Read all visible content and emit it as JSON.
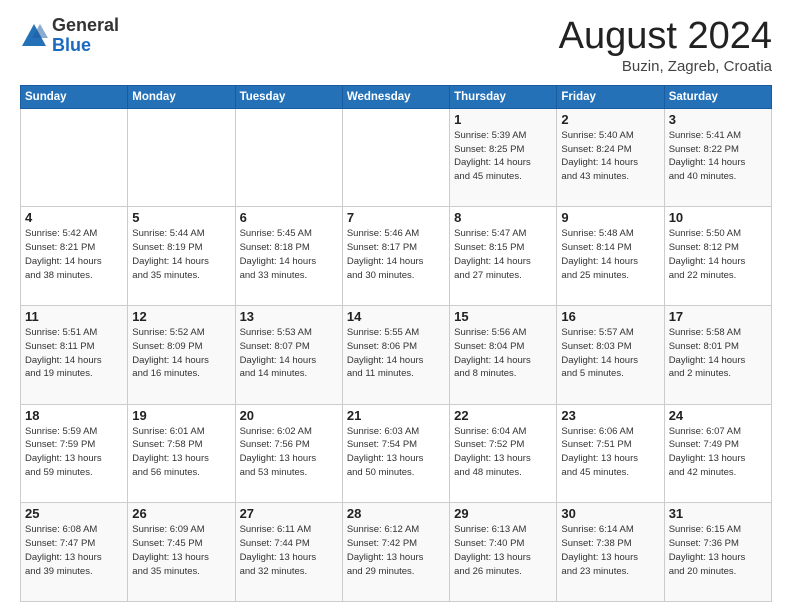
{
  "header": {
    "logo_general": "General",
    "logo_blue": "Blue",
    "month_title": "August 2024",
    "location": "Buzin, Zagreb, Croatia"
  },
  "days_of_week": [
    "Sunday",
    "Monday",
    "Tuesday",
    "Wednesday",
    "Thursday",
    "Friday",
    "Saturday"
  ],
  "weeks": [
    [
      {
        "day": "",
        "content": ""
      },
      {
        "day": "",
        "content": ""
      },
      {
        "day": "",
        "content": ""
      },
      {
        "day": "",
        "content": ""
      },
      {
        "day": "1",
        "content": "Sunrise: 5:39 AM\nSunset: 8:25 PM\nDaylight: 14 hours\nand 45 minutes."
      },
      {
        "day": "2",
        "content": "Sunrise: 5:40 AM\nSunset: 8:24 PM\nDaylight: 14 hours\nand 43 minutes."
      },
      {
        "day": "3",
        "content": "Sunrise: 5:41 AM\nSunset: 8:22 PM\nDaylight: 14 hours\nand 40 minutes."
      }
    ],
    [
      {
        "day": "4",
        "content": "Sunrise: 5:42 AM\nSunset: 8:21 PM\nDaylight: 14 hours\nand 38 minutes."
      },
      {
        "day": "5",
        "content": "Sunrise: 5:44 AM\nSunset: 8:19 PM\nDaylight: 14 hours\nand 35 minutes."
      },
      {
        "day": "6",
        "content": "Sunrise: 5:45 AM\nSunset: 8:18 PM\nDaylight: 14 hours\nand 33 minutes."
      },
      {
        "day": "7",
        "content": "Sunrise: 5:46 AM\nSunset: 8:17 PM\nDaylight: 14 hours\nand 30 minutes."
      },
      {
        "day": "8",
        "content": "Sunrise: 5:47 AM\nSunset: 8:15 PM\nDaylight: 14 hours\nand 27 minutes."
      },
      {
        "day": "9",
        "content": "Sunrise: 5:48 AM\nSunset: 8:14 PM\nDaylight: 14 hours\nand 25 minutes."
      },
      {
        "day": "10",
        "content": "Sunrise: 5:50 AM\nSunset: 8:12 PM\nDaylight: 14 hours\nand 22 minutes."
      }
    ],
    [
      {
        "day": "11",
        "content": "Sunrise: 5:51 AM\nSunset: 8:11 PM\nDaylight: 14 hours\nand 19 minutes."
      },
      {
        "day": "12",
        "content": "Sunrise: 5:52 AM\nSunset: 8:09 PM\nDaylight: 14 hours\nand 16 minutes."
      },
      {
        "day": "13",
        "content": "Sunrise: 5:53 AM\nSunset: 8:07 PM\nDaylight: 14 hours\nand 14 minutes."
      },
      {
        "day": "14",
        "content": "Sunrise: 5:55 AM\nSunset: 8:06 PM\nDaylight: 14 hours\nand 11 minutes."
      },
      {
        "day": "15",
        "content": "Sunrise: 5:56 AM\nSunset: 8:04 PM\nDaylight: 14 hours\nand 8 minutes."
      },
      {
        "day": "16",
        "content": "Sunrise: 5:57 AM\nSunset: 8:03 PM\nDaylight: 14 hours\nand 5 minutes."
      },
      {
        "day": "17",
        "content": "Sunrise: 5:58 AM\nSunset: 8:01 PM\nDaylight: 14 hours\nand 2 minutes."
      }
    ],
    [
      {
        "day": "18",
        "content": "Sunrise: 5:59 AM\nSunset: 7:59 PM\nDaylight: 13 hours\nand 59 minutes."
      },
      {
        "day": "19",
        "content": "Sunrise: 6:01 AM\nSunset: 7:58 PM\nDaylight: 13 hours\nand 56 minutes."
      },
      {
        "day": "20",
        "content": "Sunrise: 6:02 AM\nSunset: 7:56 PM\nDaylight: 13 hours\nand 53 minutes."
      },
      {
        "day": "21",
        "content": "Sunrise: 6:03 AM\nSunset: 7:54 PM\nDaylight: 13 hours\nand 50 minutes."
      },
      {
        "day": "22",
        "content": "Sunrise: 6:04 AM\nSunset: 7:52 PM\nDaylight: 13 hours\nand 48 minutes."
      },
      {
        "day": "23",
        "content": "Sunrise: 6:06 AM\nSunset: 7:51 PM\nDaylight: 13 hours\nand 45 minutes."
      },
      {
        "day": "24",
        "content": "Sunrise: 6:07 AM\nSunset: 7:49 PM\nDaylight: 13 hours\nand 42 minutes."
      }
    ],
    [
      {
        "day": "25",
        "content": "Sunrise: 6:08 AM\nSunset: 7:47 PM\nDaylight: 13 hours\nand 39 minutes."
      },
      {
        "day": "26",
        "content": "Sunrise: 6:09 AM\nSunset: 7:45 PM\nDaylight: 13 hours\nand 35 minutes."
      },
      {
        "day": "27",
        "content": "Sunrise: 6:11 AM\nSunset: 7:44 PM\nDaylight: 13 hours\nand 32 minutes."
      },
      {
        "day": "28",
        "content": "Sunrise: 6:12 AM\nSunset: 7:42 PM\nDaylight: 13 hours\nand 29 minutes."
      },
      {
        "day": "29",
        "content": "Sunrise: 6:13 AM\nSunset: 7:40 PM\nDaylight: 13 hours\nand 26 minutes."
      },
      {
        "day": "30",
        "content": "Sunrise: 6:14 AM\nSunset: 7:38 PM\nDaylight: 13 hours\nand 23 minutes."
      },
      {
        "day": "31",
        "content": "Sunrise: 6:15 AM\nSunset: 7:36 PM\nDaylight: 13 hours\nand 20 minutes."
      }
    ]
  ]
}
